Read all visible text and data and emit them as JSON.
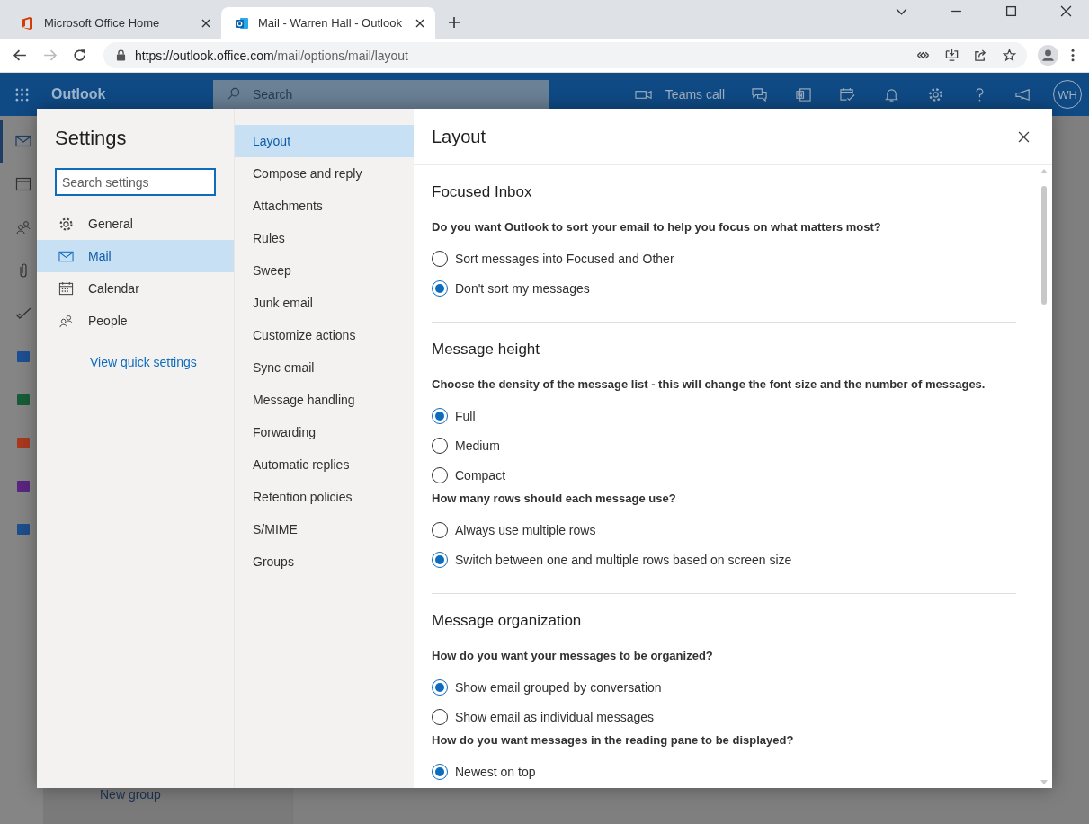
{
  "browser": {
    "tabs": [
      {
        "title": "Microsoft Office Home",
        "kind": "office",
        "selected": false
      },
      {
        "title": "Mail - Warren Hall - Outlook",
        "kind": "outlook",
        "selected": true
      }
    ],
    "url_host": "https://outlook.office.com",
    "url_path": "/mail/options/mail/layout"
  },
  "header": {
    "app_name": "Outlook",
    "search_placeholder": "Search",
    "teams_call": "Teams call",
    "avatar": "WH"
  },
  "rail": [
    {
      "kind": "mail",
      "selected": true
    },
    {
      "kind": "calendar",
      "selected": false
    },
    {
      "kind": "people",
      "selected": false
    },
    {
      "kind": "attachment",
      "selected": false
    },
    {
      "kind": "todo",
      "selected": false
    },
    {
      "kind": "word",
      "selected": false
    },
    {
      "kind": "excel",
      "selected": false
    },
    {
      "kind": "powerpoint",
      "selected": false
    },
    {
      "kind": "onenote",
      "selected": false
    },
    {
      "kind": "yammer",
      "selected": false
    }
  ],
  "background": {
    "new_group": "New group"
  },
  "settings": {
    "title": "Settings",
    "search_placeholder": "Search settings",
    "categories": [
      {
        "label": "General",
        "kind": "gear",
        "selected": false
      },
      {
        "label": "Mail",
        "kind": "mail",
        "selected": true
      },
      {
        "label": "Calendar",
        "kind": "calendar",
        "selected": false
      },
      {
        "label": "People",
        "kind": "people",
        "selected": false
      }
    ],
    "quick_link": "View quick settings",
    "subcategories": [
      {
        "label": "Layout",
        "selected": true
      },
      {
        "label": "Compose and reply",
        "selected": false
      },
      {
        "label": "Attachments",
        "selected": false
      },
      {
        "label": "Rules",
        "selected": false
      },
      {
        "label": "Sweep",
        "selected": false
      },
      {
        "label": "Junk email",
        "selected": false
      },
      {
        "label": "Customize actions",
        "selected": false
      },
      {
        "label": "Sync email",
        "selected": false
      },
      {
        "label": "Message handling",
        "selected": false
      },
      {
        "label": "Forwarding",
        "selected": false
      },
      {
        "label": "Automatic replies",
        "selected": false
      },
      {
        "label": "Retention policies",
        "selected": false
      },
      {
        "label": "S/MIME",
        "selected": false
      },
      {
        "label": "Groups",
        "selected": false
      }
    ],
    "panel_title": "Layout",
    "sections": [
      {
        "heading": "Focused Inbox",
        "groups": [
          {
            "question": "Do you want Outlook to sort your email to help you focus on what matters most?",
            "options": [
              {
                "label": "Sort messages into Focused and Other",
                "selected": false
              },
              {
                "label": "Don't sort my messages",
                "selected": true
              }
            ]
          }
        ]
      },
      {
        "heading": "Message height",
        "groups": [
          {
            "question": "Choose the density of the message list - this will change the font size and the number of messages.",
            "options": [
              {
                "label": "Full",
                "selected": true
              },
              {
                "label": "Medium",
                "selected": false
              },
              {
                "label": "Compact",
                "selected": false
              }
            ]
          },
          {
            "question": "How many rows should each message use?",
            "options": [
              {
                "label": "Always use multiple rows",
                "selected": false
              },
              {
                "label": "Switch between one and multiple rows based on screen size",
                "selected": true
              }
            ]
          }
        ]
      },
      {
        "heading": "Message organization",
        "groups": [
          {
            "question": "How do you want your messages to be organized?",
            "options": [
              {
                "label": "Show email grouped by conversation",
                "selected": true
              },
              {
                "label": "Show email as individual messages",
                "selected": false
              }
            ]
          },
          {
            "question": "How do you want messages in the reading pane to be displayed?",
            "options": [
              {
                "label": "Newest on top",
                "selected": true
              }
            ]
          }
        ]
      }
    ]
  }
}
